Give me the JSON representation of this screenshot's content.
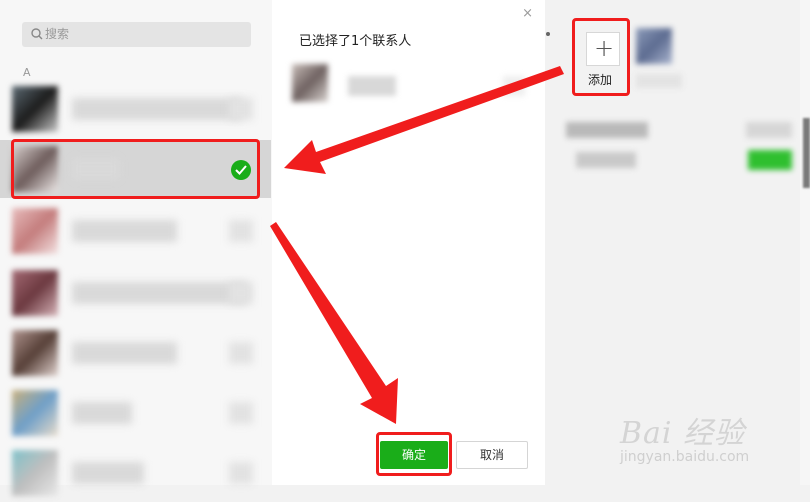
{
  "left_panel": {
    "search_placeholder": "搜索",
    "section_letter": "A",
    "contacts": [
      {
        "avatar_colors": [
          "#5d6b74",
          "#1c1c1c",
          "#c9c9c9"
        ],
        "name_width": 170,
        "selected": false
      },
      {
        "avatar_colors": [
          "#d8cfcd",
          "#6e5d5c",
          "#ece7e6"
        ],
        "name_width": 48,
        "selected": true
      },
      {
        "avatar_colors": [
          "#e7bcbc",
          "#c47d7d",
          "#f3e2e2"
        ],
        "name_width": 105,
        "selected": false
      },
      {
        "avatar_colors": [
          "#a46a74",
          "#6c3940",
          "#d6b3b8"
        ],
        "name_width": 175,
        "selected": false
      },
      {
        "avatar_colors": [
          "#b0958f",
          "#574038",
          "#e0d2ce"
        ],
        "name_width": 105,
        "selected": false
      },
      {
        "avatar_colors": [
          "#c9b07c",
          "#6f9fc8",
          "#e8dccb"
        ],
        "name_width": 60,
        "selected": false
      },
      {
        "avatar_colors": [
          "#7ec1c9",
          "#bfbfbf",
          "#e8e8e8"
        ],
        "name_width": 72,
        "selected": false
      }
    ]
  },
  "dialog": {
    "selected_title": "已选择了1个联系人",
    "close_symbol": "×",
    "ok_label": "确定",
    "cancel_label": "取消"
  },
  "background_app": {
    "add_symbol": "+",
    "add_label": "添加"
  },
  "watermark": {
    "logo": "Bai 经验",
    "url": "jingyan.baidu.com"
  },
  "colors": {
    "accent_green": "#1aad19",
    "highlight_red": "#f01d1d"
  }
}
